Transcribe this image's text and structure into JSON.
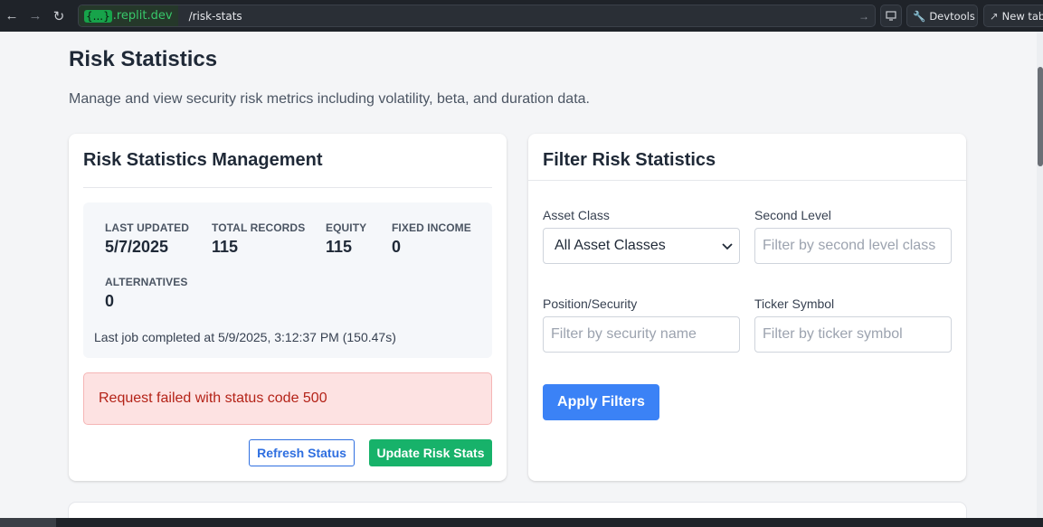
{
  "browser": {
    "domain_badge": "{...}",
    "domain": ".replit.dev",
    "path": "/risk-stats",
    "devtools_label": "Devtools",
    "newtab_label": "New tab"
  },
  "page": {
    "title": "Risk Statistics",
    "subtitle": "Manage and view security risk metrics including volatility, beta, and duration data."
  },
  "management": {
    "title": "Risk Statistics Management",
    "stats": [
      {
        "label": "LAST UPDATED",
        "value": "5/7/2025"
      },
      {
        "label": "TOTAL RECORDS",
        "value": "115"
      },
      {
        "label": "EQUITY",
        "value": "115"
      },
      {
        "label": "FIXED INCOME",
        "value": "0"
      },
      {
        "label": "ALTERNATIVES",
        "value": "0"
      }
    ],
    "job_status": "Last job completed at 5/9/2025, 3:12:37 PM (150.47s)",
    "error_message": "Request failed with status code 500",
    "refresh_label": "Refresh Status",
    "update_label": "Update Risk Stats"
  },
  "filters": {
    "title": "Filter Risk Statistics",
    "asset_class": {
      "label": "Asset Class",
      "value": "All Asset Classes"
    },
    "second_level": {
      "label": "Second Level",
      "placeholder": "Filter by second level class"
    },
    "position": {
      "label": "Position/Security",
      "placeholder": "Filter by security name"
    },
    "ticker": {
      "label": "Ticker Symbol",
      "placeholder": "Filter by ticker symbol"
    },
    "apply_label": "Apply Filters"
  },
  "colors": {
    "primary": "#3b82f6",
    "success": "#17b26a",
    "error_bg": "#fde2e2",
    "error_text": "#b42318"
  }
}
